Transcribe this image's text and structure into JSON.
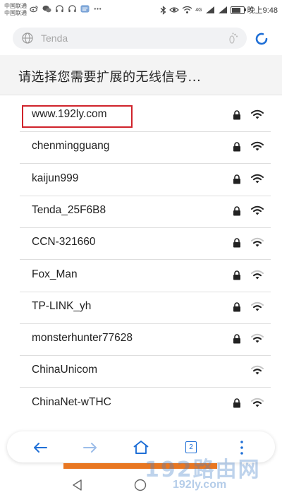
{
  "status_bar": {
    "carrier_1": "中国联通",
    "carrier_2": "中国联通",
    "network_type": "4G",
    "time": "晚上9:48",
    "battery_level_percent": 75
  },
  "address_bar": {
    "url": "Tenda"
  },
  "page": {
    "heading": "请选择您需要扩展的无线信号..."
  },
  "networks": [
    {
      "ssid": "www.192ly.com",
      "secured": true,
      "signal": "strong"
    },
    {
      "ssid": "chenmingguang",
      "secured": true,
      "signal": "strong"
    },
    {
      "ssid": "kaijun999",
      "secured": true,
      "signal": "strong"
    },
    {
      "ssid": "Tenda_25F6B8",
      "secured": true,
      "signal": "strong"
    },
    {
      "ssid": "CCN-321660",
      "secured": true,
      "signal": "weak"
    },
    {
      "ssid": "Fox_Man",
      "secured": true,
      "signal": "weak"
    },
    {
      "ssid": "TP-LINK_yh",
      "secured": true,
      "signal": "weak"
    },
    {
      "ssid": "monsterhunter77628",
      "secured": true,
      "signal": "weak"
    },
    {
      "ssid": "ChinaUnicom",
      "secured": false,
      "signal": "weak"
    },
    {
      "ssid": "ChinaNet-wTHC",
      "secured": true,
      "signal": "weak"
    }
  ],
  "toolbar": {
    "tab_count": "2",
    "icons": [
      "back-arrow-icon",
      "forward-arrow-icon",
      "home-icon",
      "tabs-icon",
      "more-icon"
    ]
  },
  "watermark": {
    "main": "192路由网",
    "site": "192ly.com"
  },
  "colors": {
    "accent": "#1f6fd6",
    "highlight": "#d0232b",
    "orange": "#e87722"
  }
}
